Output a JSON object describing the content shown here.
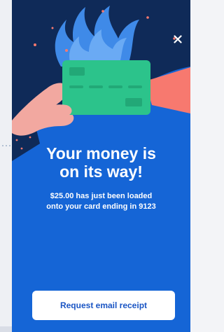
{
  "modal": {
    "headline_line1": "Your money is",
    "headline_line2": "on its way!",
    "message_line1": "$25.00 has just been loaded",
    "message_line2": "onto your card ending in 9123",
    "close_icon": "close-icon",
    "receipt_button_label": "Request email receipt"
  },
  "colors": {
    "modal_bg": "#1565d6",
    "dark_bg": "#0f2a58",
    "card": "#2cc38b",
    "flame": "#3f8ae8",
    "hand": "#f2a8a0",
    "sleeve_right": "#f7796f",
    "button_text": "#1a55c4"
  }
}
